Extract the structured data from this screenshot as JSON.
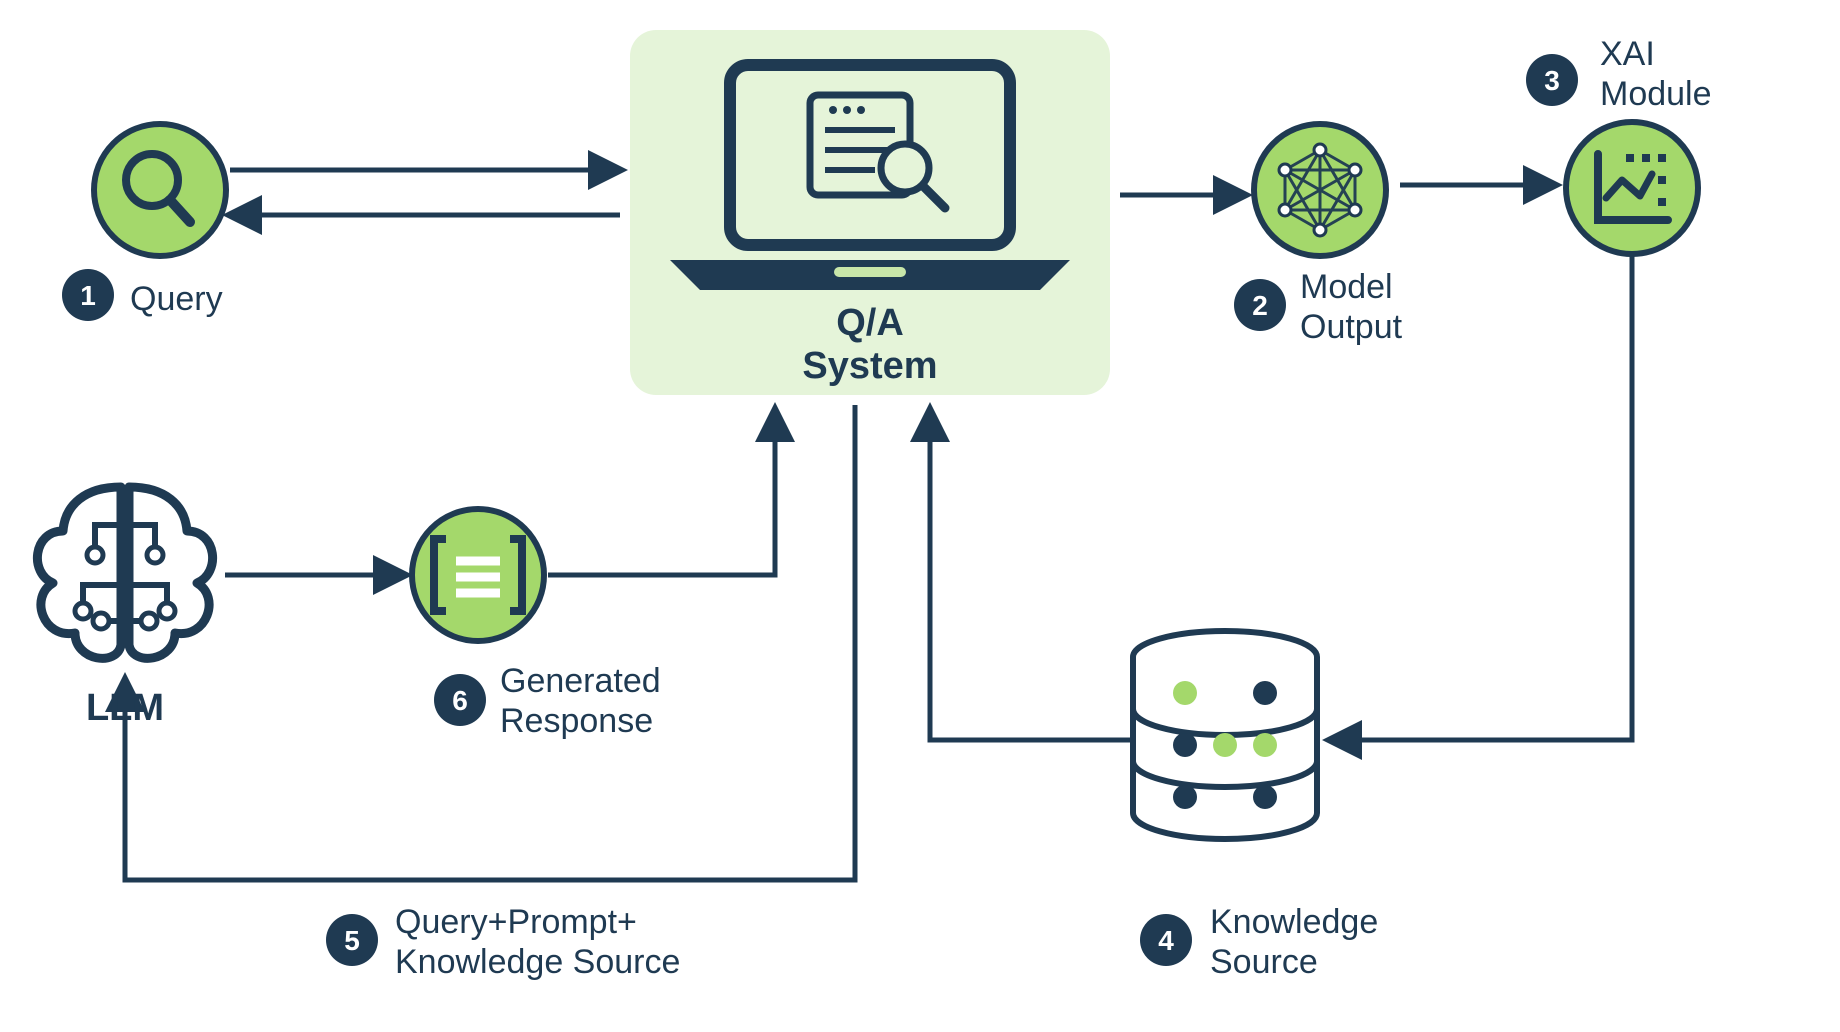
{
  "nodes": {
    "query": {
      "badge": "1",
      "label": "Query"
    },
    "qa": {
      "line1": "Q/A",
      "line2": "System"
    },
    "model": {
      "badge": "2",
      "line1": "Model",
      "line2": "Output"
    },
    "xai": {
      "badge": "3",
      "line1": "XAI",
      "line2": "Module"
    },
    "ks": {
      "badge": "4",
      "line1": "Knowledge",
      "line2": "Source"
    },
    "qpk": {
      "badge": "5",
      "line1": "Query+Prompt+",
      "line2": "Knowledge Source"
    },
    "gen": {
      "badge": "6",
      "line1": "Generated",
      "line2": "Response"
    },
    "llm": {
      "label": "LLM"
    }
  },
  "colors": {
    "navy": "#1f3a52",
    "green": "#a4d86b",
    "greenPale": "#e5f4d9",
    "greenMid": "#9fd66a",
    "white": "#ffffff"
  }
}
